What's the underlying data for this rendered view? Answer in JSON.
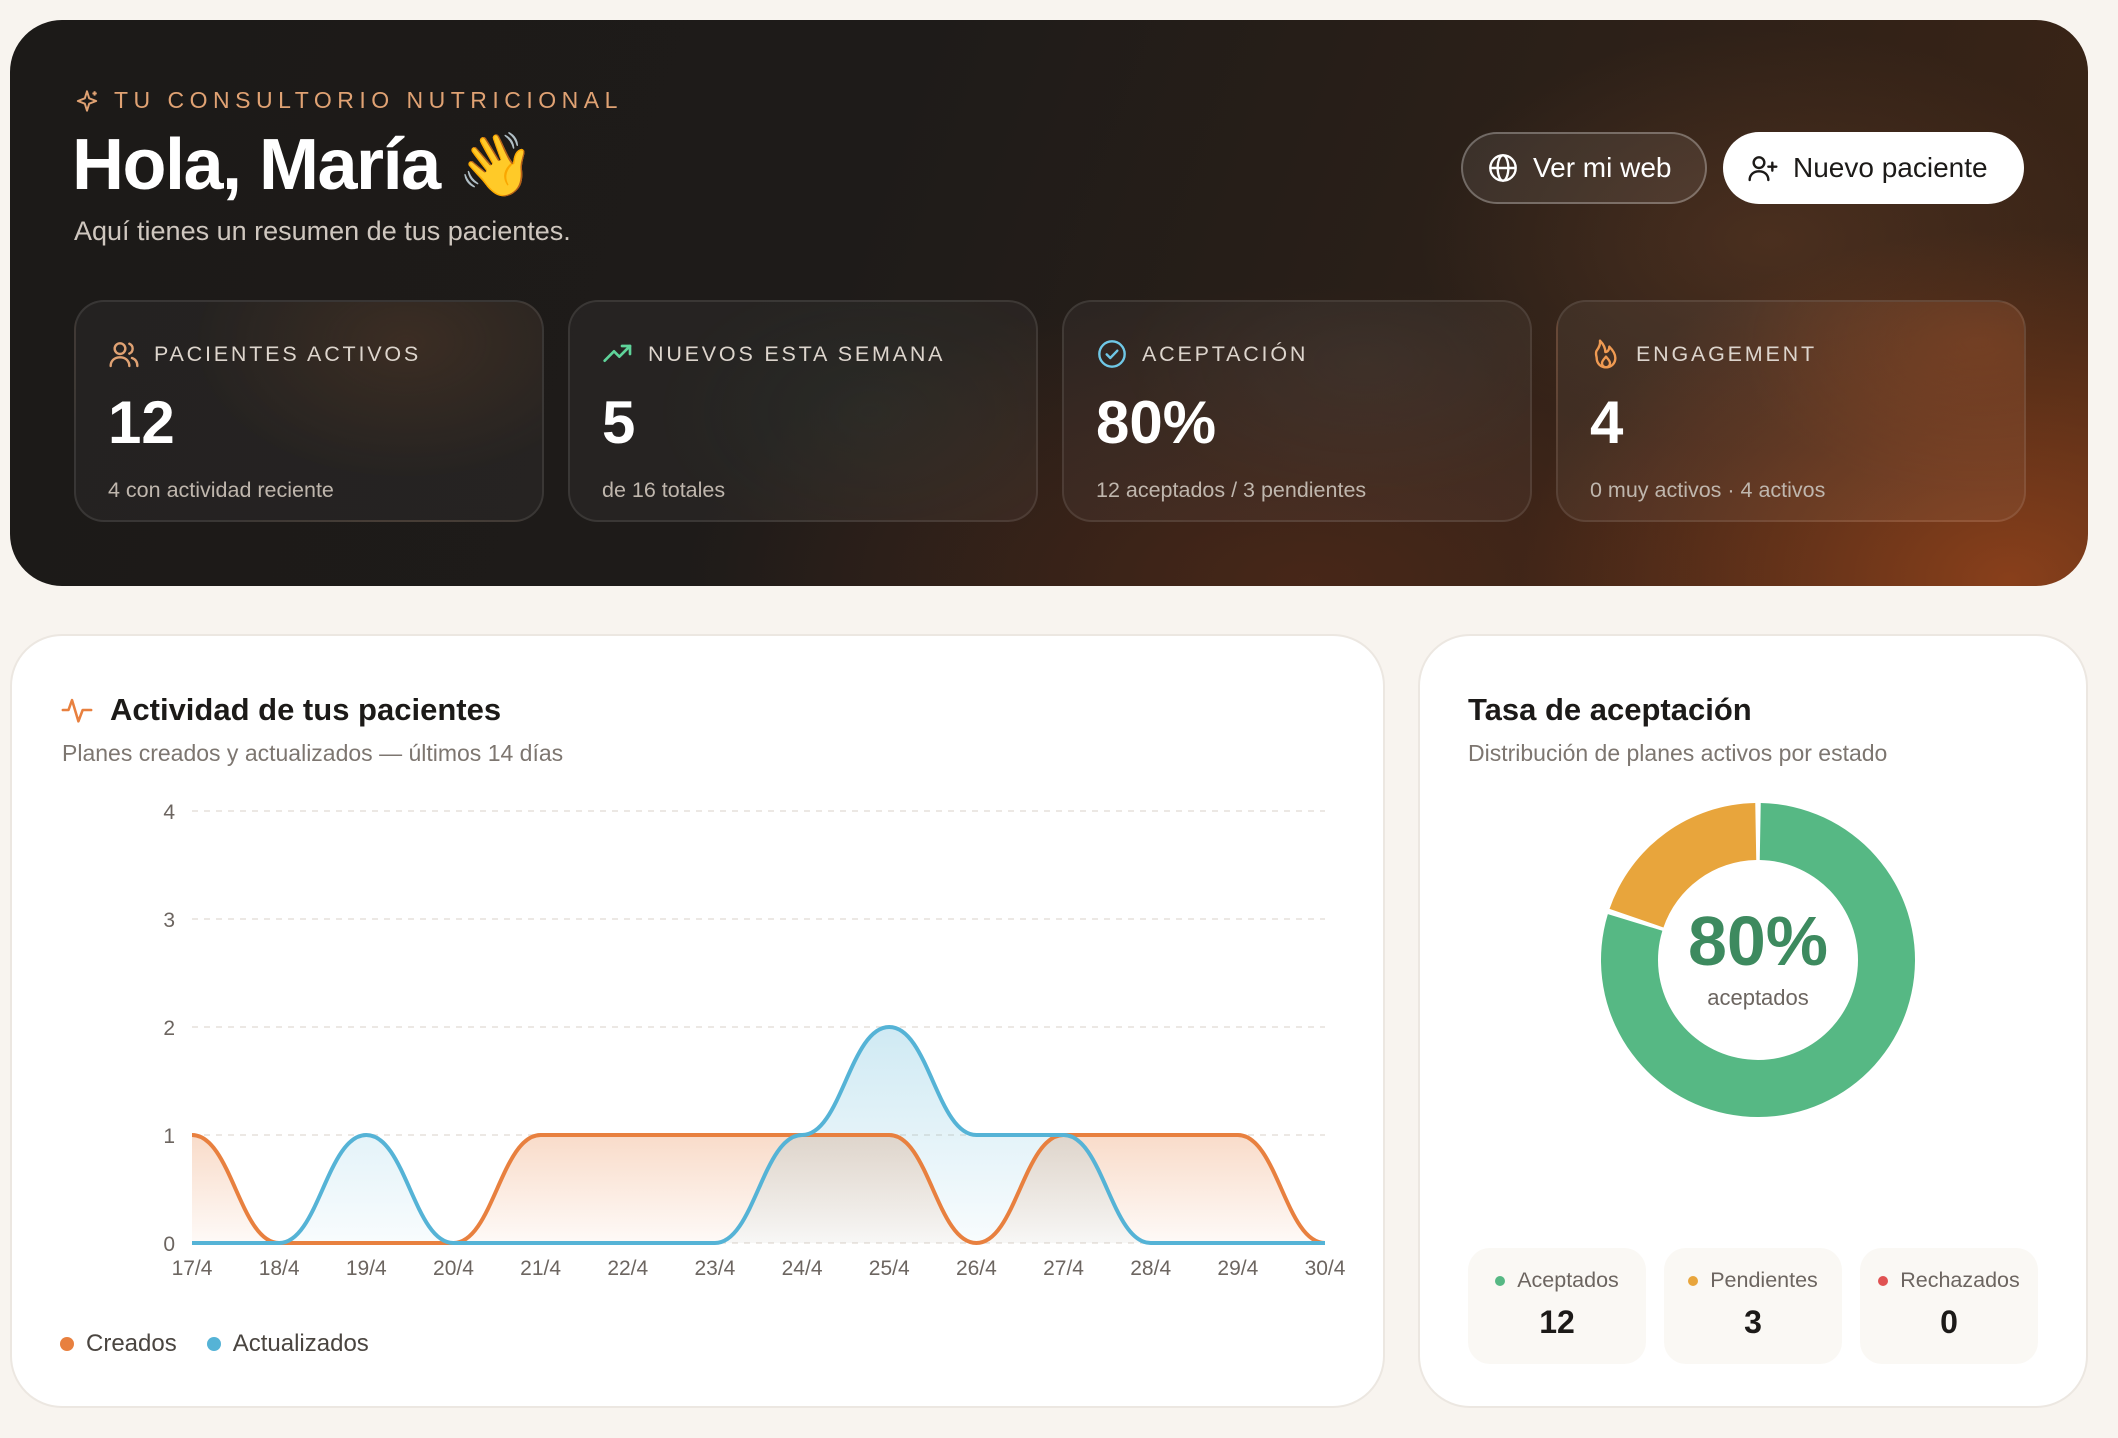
{
  "hero": {
    "eyebrow": "TU CONSULTORIO NUTRICIONAL",
    "greeting": "Hola, María",
    "wave_emoji": "👋",
    "subtitle": "Aquí tienes un resumen de tus pacientes.",
    "buttons": {
      "web": {
        "label": "Ver mi web",
        "icon": "globe-icon"
      },
      "new_patient": {
        "label": "Nuevo paciente",
        "icon": "user-plus-icon"
      }
    },
    "stats": [
      {
        "label": "PACIENTES ACTIVOS",
        "value": "12",
        "note": "4 con actividad reciente",
        "icon": "users-icon",
        "icon_color": "#e0a273"
      },
      {
        "label": "NUEVOS ESTA SEMANA",
        "value": "5",
        "note": "de 16 totales",
        "icon": "trending-up-icon",
        "icon_color": "#5fd39a"
      },
      {
        "label": "ACEPTACIÓN",
        "value": "80%",
        "note": "12 aceptados / 3 pendientes",
        "icon": "check-circle-icon",
        "icon_color": "#6fc7e6"
      },
      {
        "label": "ENGAGEMENT",
        "value": "4",
        "note": "0 muy activos · 4 activos",
        "icon": "flame-icon",
        "icon_color": "#ef9a52"
      }
    ]
  },
  "activity": {
    "title": "Actividad de tus pacientes",
    "subtitle": "Planes creados y actualizados — últimos 14 días",
    "legend": [
      "Creados",
      "Actualizados"
    ]
  },
  "chart_data": {
    "type": "area",
    "categories": [
      "17/4",
      "18/4",
      "19/4",
      "20/4",
      "21/4",
      "22/4",
      "23/4",
      "24/4",
      "25/4",
      "26/4",
      "27/4",
      "28/4",
      "29/4",
      "30/4"
    ],
    "series": [
      {
        "name": "Creados",
        "color": "#e8803f",
        "values": [
          1,
          0,
          0,
          0,
          1,
          1,
          1,
          1,
          1,
          0,
          1,
          1,
          1,
          0
        ]
      },
      {
        "name": "Actualizados",
        "color": "#55b3d6",
        "values": [
          0,
          0,
          1,
          0,
          0,
          0,
          0,
          1,
          2,
          1,
          1,
          0,
          0,
          0
        ]
      }
    ],
    "yticks": [
      "0",
      "1",
      "2",
      "3",
      "4"
    ],
    "ylim": [
      0,
      4
    ],
    "grid": true,
    "legend_position": "bottom-left"
  },
  "acceptance": {
    "title": "Tasa de aceptación",
    "subtitle": "Distribución de planes activos por estado",
    "center_value": "80%",
    "center_label": "aceptados",
    "donut": [
      {
        "name": "Aceptados",
        "value": 12,
        "color": "#56b884"
      },
      {
        "name": "Pendientes",
        "value": 3,
        "color": "#e8a53c"
      },
      {
        "name": "Rechazados",
        "value": 0,
        "color": "#e05252"
      }
    ],
    "pills": [
      {
        "label": "Aceptados",
        "value": "12",
        "color": "#56b884"
      },
      {
        "label": "Pendientes",
        "value": "3",
        "color": "#e8a53c"
      },
      {
        "label": "Rechazados",
        "value": "0",
        "color": "#e05252"
      }
    ]
  }
}
